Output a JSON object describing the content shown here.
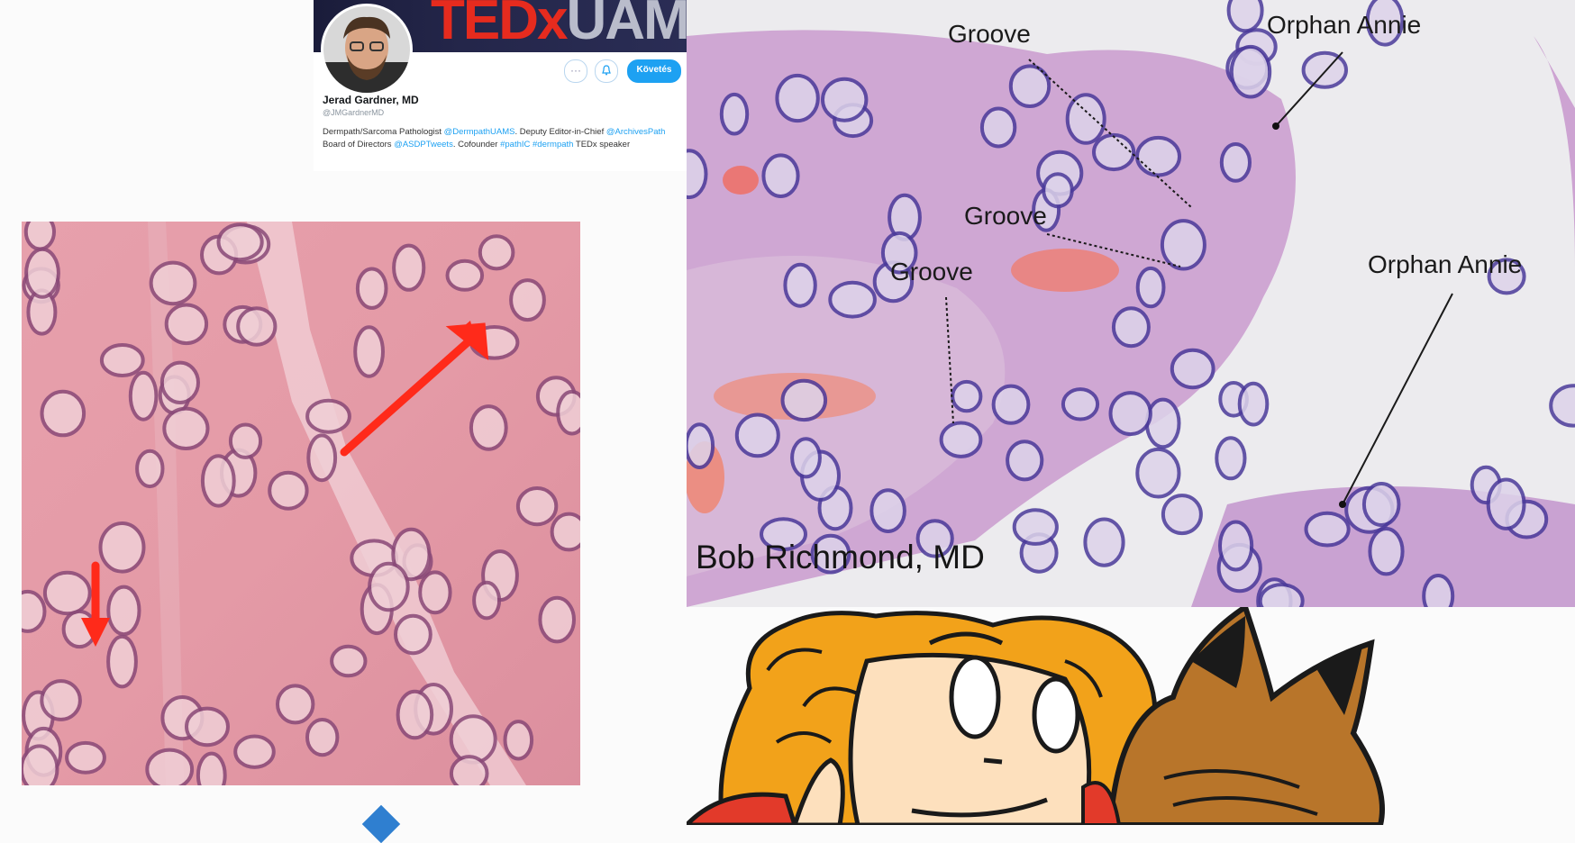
{
  "profile": {
    "banner_text_ted": "TEDx",
    "banner_text_rest": "UAMS",
    "name": "Jerad Gardner, MD",
    "handle": "@JMGardnerMD",
    "follow_label": "Követés",
    "more_label": "···",
    "notify_icon": "bell-plus-icon",
    "bio_prefix": "Dermpath/Sarcoma Pathologist ",
    "bio_link1": "@DermpathUAMS",
    "bio_mid1": ". Deputy Editor-in-Chief ",
    "bio_link2": "@ArchivesPath",
    "bio_mid2": " Board of Directors ",
    "bio_link3": "@ASDPTweets",
    "bio_mid3": ". Cofounder ",
    "bio_link4": "#pathIC #dermpath",
    "bio_suffix": " TEDx speaker"
  },
  "right_image": {
    "labels": {
      "groove_1": "Groove",
      "groove_2": "Groove",
      "groove_3": "Groove",
      "orphan_annie_1": "Orphan Annie",
      "orphan_annie_2": "Orphan Annie"
    },
    "credit": "Bob Richmond, MD"
  },
  "colors": {
    "he_pink": "#e89aa8",
    "he_purple": "#c9a4d6",
    "nucleus": "#6a3d8c",
    "arrow_red": "#ff2a1a",
    "twitter_blue": "#1da1f2",
    "comic_orange": "#f2a21a"
  }
}
